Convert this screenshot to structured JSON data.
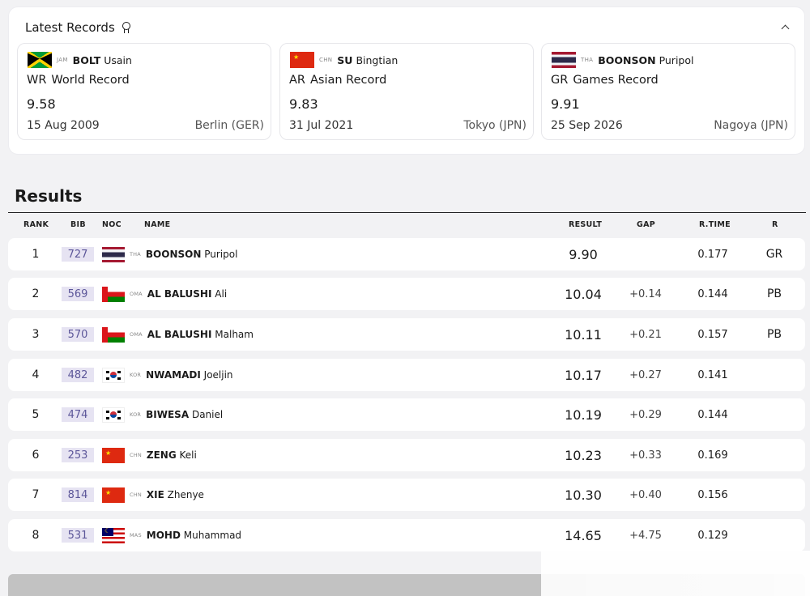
{
  "records": {
    "title": "Latest Records",
    "cards": [
      {
        "flag": "jam",
        "noc": "JAM",
        "surname": "BOLT",
        "given": "Usain",
        "abbr": "WR",
        "type": "World Record",
        "value": "9.58",
        "date": "15 Aug 2009",
        "venue": "Berlin (GER)"
      },
      {
        "flag": "chn",
        "noc": "CHN",
        "surname": "SU",
        "given": "Bingtian",
        "abbr": "AR",
        "type": "Asian Record",
        "value": "9.83",
        "date": "31 Jul 2021",
        "venue": "Tokyo (JPN)"
      },
      {
        "flag": "tha",
        "noc": "THA",
        "surname": "BOONSON",
        "given": "Puripol",
        "abbr": "GR",
        "type": "Games Record",
        "value": "9.91",
        "date": "25 Sep 2026",
        "venue": "Nagoya (JPN)"
      }
    ]
  },
  "results": {
    "title": "Results",
    "headers": {
      "rank": "RANK",
      "bib": "BIB",
      "noc": "NOC",
      "name": "NAME",
      "result": "RESULT",
      "gap": "GAP",
      "rtime": "R.TIME",
      "r": "R"
    },
    "rows": [
      {
        "rank": "1",
        "bib": "727",
        "flag": "tha",
        "noc": "THA",
        "surname": "BOONSON",
        "given": "Puripol",
        "result": "9.90",
        "gap": "",
        "rtime": "0.177",
        "r": "GR"
      },
      {
        "rank": "2",
        "bib": "569",
        "flag": "oma",
        "noc": "OMA",
        "surname": "AL BALUSHI",
        "given": "Ali",
        "result": "10.04",
        "gap": "+0.14",
        "rtime": "0.144",
        "r": "PB"
      },
      {
        "rank": "3",
        "bib": "570",
        "flag": "oma",
        "noc": "OMA",
        "surname": "AL BALUSHI",
        "given": "Malham",
        "result": "10.11",
        "gap": "+0.21",
        "rtime": "0.157",
        "r": "PB"
      },
      {
        "rank": "4",
        "bib": "482",
        "flag": "kor",
        "noc": "KOR",
        "surname": "NWAMADI",
        "given": "Joeljin",
        "result": "10.17",
        "gap": "+0.27",
        "rtime": "0.141",
        "r": ""
      },
      {
        "rank": "5",
        "bib": "474",
        "flag": "kor",
        "noc": "KOR",
        "surname": "BIWESA",
        "given": "Daniel",
        "result": "10.19",
        "gap": "+0.29",
        "rtime": "0.144",
        "r": ""
      },
      {
        "rank": "6",
        "bib": "253",
        "flag": "chn",
        "noc": "CHN",
        "surname": "ZENG",
        "given": "Keli",
        "result": "10.23",
        "gap": "+0.33",
        "rtime": "0.169",
        "r": ""
      },
      {
        "rank": "7",
        "bib": "814",
        "flag": "chn",
        "noc": "CHN",
        "surname": "XIE",
        "given": "Zhenye",
        "result": "10.30",
        "gap": "+0.40",
        "rtime": "0.156",
        "r": ""
      },
      {
        "rank": "8",
        "bib": "531",
        "flag": "mas",
        "noc": "MAS",
        "surname": "MOHD",
        "given": "Muhammad",
        "result": "14.65",
        "gap": "+4.75",
        "rtime": "0.129",
        "r": ""
      }
    ]
  },
  "colors": {
    "bib_bg": "#e6e3f2",
    "bib_text": "#5c5699",
    "page_bg": "#f2f2f4"
  }
}
